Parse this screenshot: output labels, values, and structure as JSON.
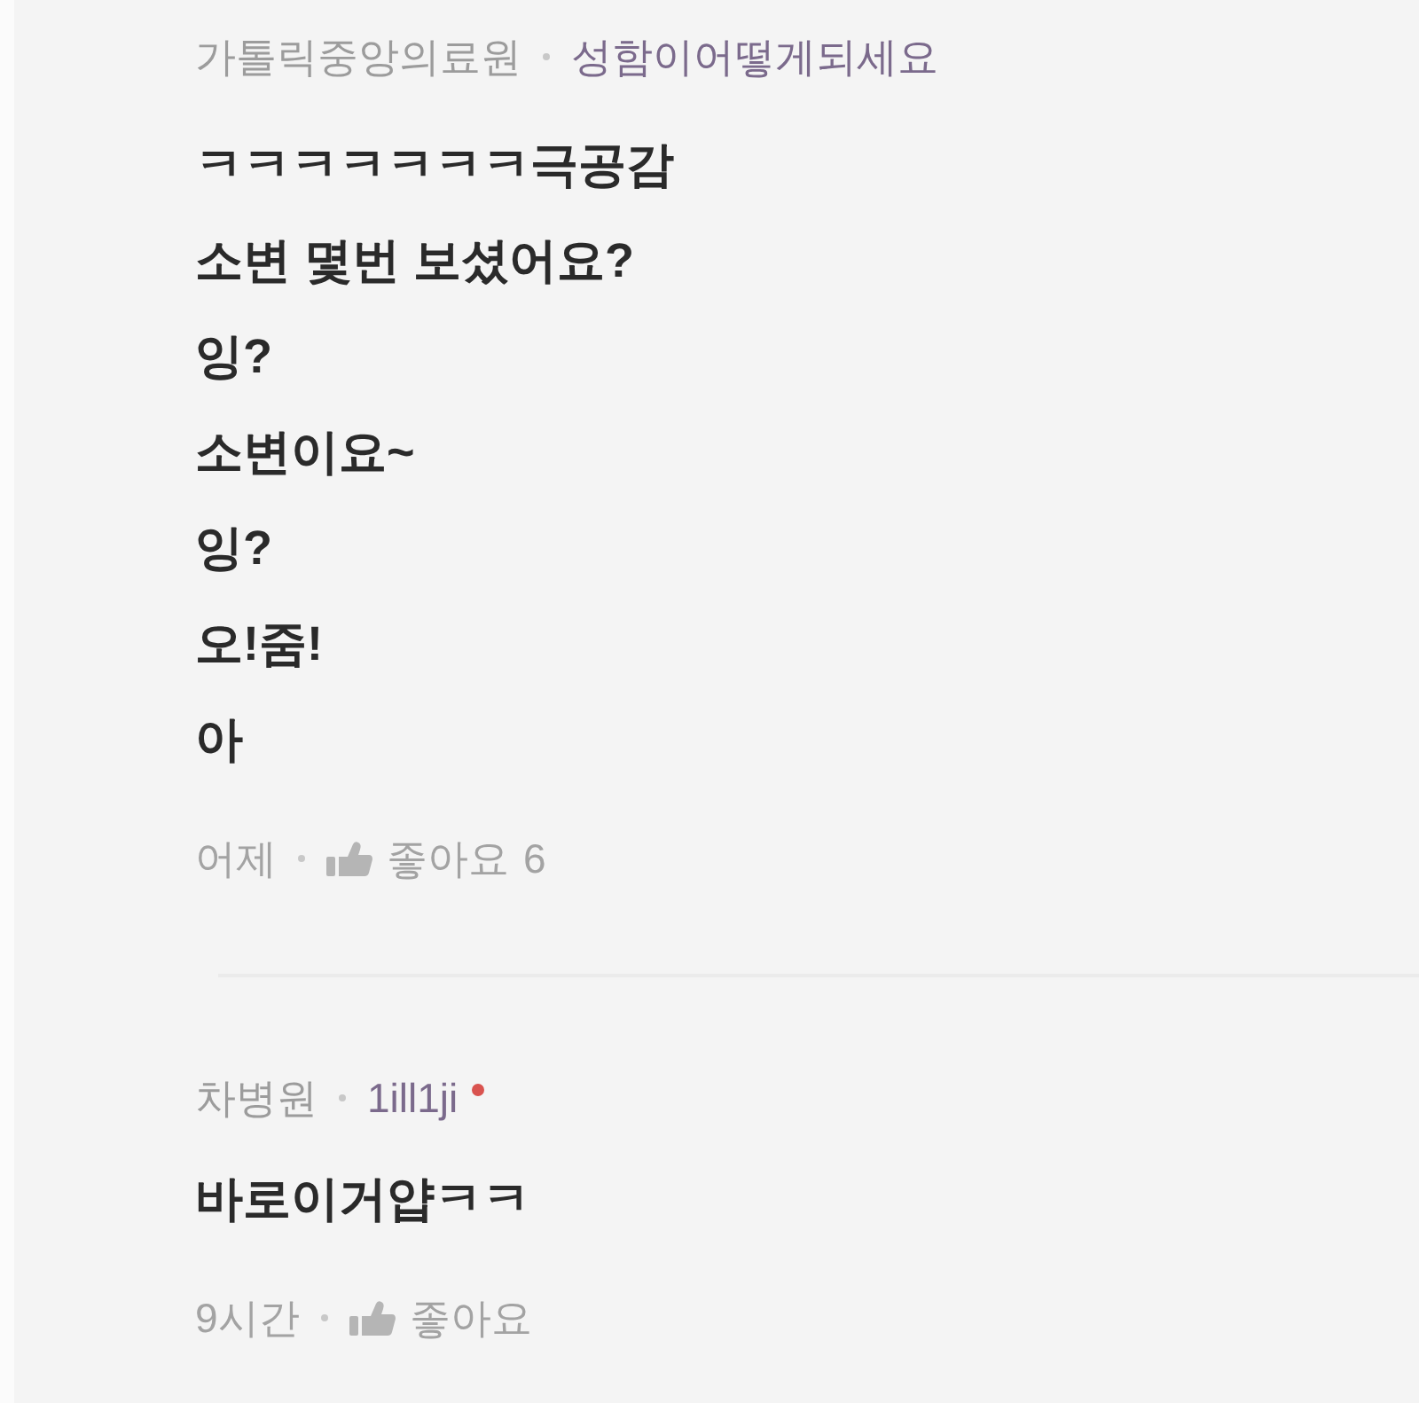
{
  "comments": [
    {
      "organization": "가톨릭중앙의료원",
      "author": "성함이어떻게되세요",
      "badge": false,
      "lines": [
        "ㅋㅋㅋㅋㅋㅋㅋ극공감",
        "소변 몇번 보셨어요?",
        "잉?",
        "소변이요~",
        "잉?",
        "오!줌!",
        "아"
      ],
      "time": "어제",
      "like_label": "좋아요",
      "like_count": "6"
    },
    {
      "organization": "차병원",
      "author": "1ill1ji",
      "badge": true,
      "lines": [
        "바로이거얍ㅋㅋ"
      ],
      "time": "9시간",
      "like_label": "좋아요"
    }
  ]
}
